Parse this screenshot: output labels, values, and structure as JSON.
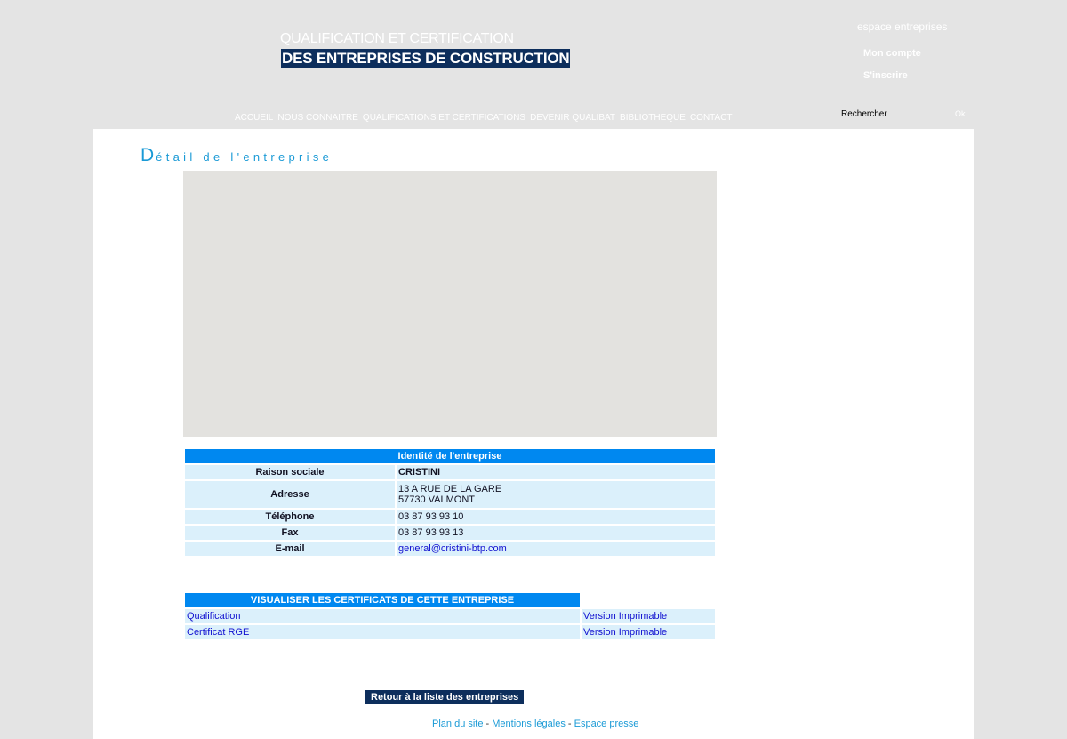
{
  "header": {
    "title_line1": "QUALIFICATION ET CERTIFICATION",
    "title_line2": "DES ENTREPRISES DE CONSTRUCTION",
    "espace": "espace entreprises",
    "mon_compte": "Mon compte",
    "inscrire": "S'inscrire",
    "search_placeholder": "Rechercher",
    "ok": "Ok"
  },
  "nav": [
    "ACCUEIL",
    "NOUS CONNAITRE",
    "QUALIFICATIONS ET CERTIFICATIONS",
    "DEVENIR QUALIBAT",
    "BIBLIOTHEQUE",
    "CONTACT"
  ],
  "page": {
    "title_first": "D",
    "title_rest": "étail de l'entreprise"
  },
  "identity": {
    "header": "Identité de l'entreprise",
    "rows": [
      {
        "label": "Raison sociale",
        "value": "CRISTINI"
      },
      {
        "label": "Adresse",
        "value": "13 A RUE DE LA GARE",
        "value2": "57730 VALMONT"
      },
      {
        "label": "Téléphone",
        "value": "03 87 93 93 10"
      },
      {
        "label": "Fax",
        "value": "03 87 93 93 13"
      },
      {
        "label": "E-mail",
        "value": "general@cristini-btp.com"
      }
    ]
  },
  "certificates": {
    "header": "VISUALISER LES CERTIFICATS DE CETTE ENTREPRISE",
    "rows": [
      {
        "name": "Qualification",
        "print": "Version Imprimable"
      },
      {
        "name": "Certificat RGE",
        "print": "Version Imprimable"
      }
    ]
  },
  "back_button": "Retour à la liste des entreprises",
  "footer": {
    "plan": "Plan du site",
    "sep": " - ",
    "mentions": "Mentions légales",
    "presse": "Espace presse"
  },
  "colors": {
    "accent": "#0088f0",
    "navy": "#0d2e5c",
    "row": "#dbf0fb",
    "link": "#1a9ad6"
  }
}
